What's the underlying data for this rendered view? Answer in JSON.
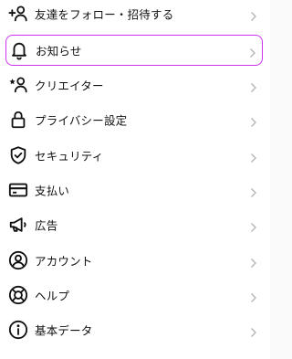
{
  "menu": {
    "items": [
      {
        "label": "友達をフォロー・招待する",
        "icon": "add-person-icon"
      },
      {
        "label": "お知らせ",
        "icon": "bell-icon",
        "highlighted": true
      },
      {
        "label": "クリエイター",
        "icon": "creator-icon"
      },
      {
        "label": "プライバシー設定",
        "icon": "lock-icon"
      },
      {
        "label": "セキュリティ",
        "icon": "shield-check-icon"
      },
      {
        "label": "支払い",
        "icon": "credit-card-icon"
      },
      {
        "label": "広告",
        "icon": "megaphone-icon"
      },
      {
        "label": "アカウント",
        "icon": "account-icon"
      },
      {
        "label": "ヘルプ",
        "icon": "lifebuoy-icon"
      },
      {
        "label": "基本データ",
        "icon": "info-icon"
      }
    ]
  },
  "colors": {
    "highlight_border": "#cc33ee",
    "chevron": "#b5b5b5",
    "text": "#111111"
  }
}
